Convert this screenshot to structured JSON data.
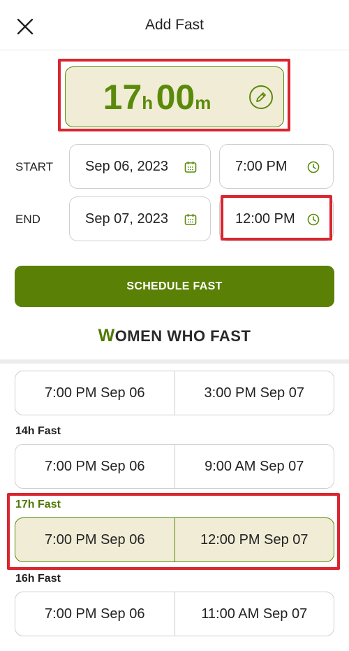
{
  "header": {
    "title": "Add Fast",
    "close_icon": "close-icon"
  },
  "duration": {
    "hours": "17",
    "hours_unit": "h",
    "minutes": "00",
    "minutes_unit": "m"
  },
  "start": {
    "label": "START",
    "date": "Sep 06, 2023",
    "time": "7:00 PM"
  },
  "end": {
    "label": "END",
    "date": "Sep 07, 2023",
    "time": "12:00 PM"
  },
  "schedule_button": "SCHEDULE FAST",
  "logo": {
    "first_letter": "W",
    "rest": "OMEN WHO FAST"
  },
  "options": [
    {
      "label": "",
      "start": "7:00 PM Sep 06",
      "end": "3:00 PM Sep 07",
      "selected": false
    },
    {
      "label": "14h Fast",
      "start": "7:00 PM Sep 06",
      "end": "9:00 AM Sep 07",
      "selected": false
    },
    {
      "label": "17h Fast",
      "start": "7:00 PM Sep 06",
      "end": "12:00 PM Sep 07",
      "selected": true
    },
    {
      "label": "16h Fast",
      "start": "7:00 PM Sep 06",
      "end": "11:00 AM Sep 07",
      "selected": false
    }
  ],
  "colors": {
    "accent": "#5a8105",
    "selected_bg": "#f1ecd6",
    "highlight": "#d9262f"
  }
}
